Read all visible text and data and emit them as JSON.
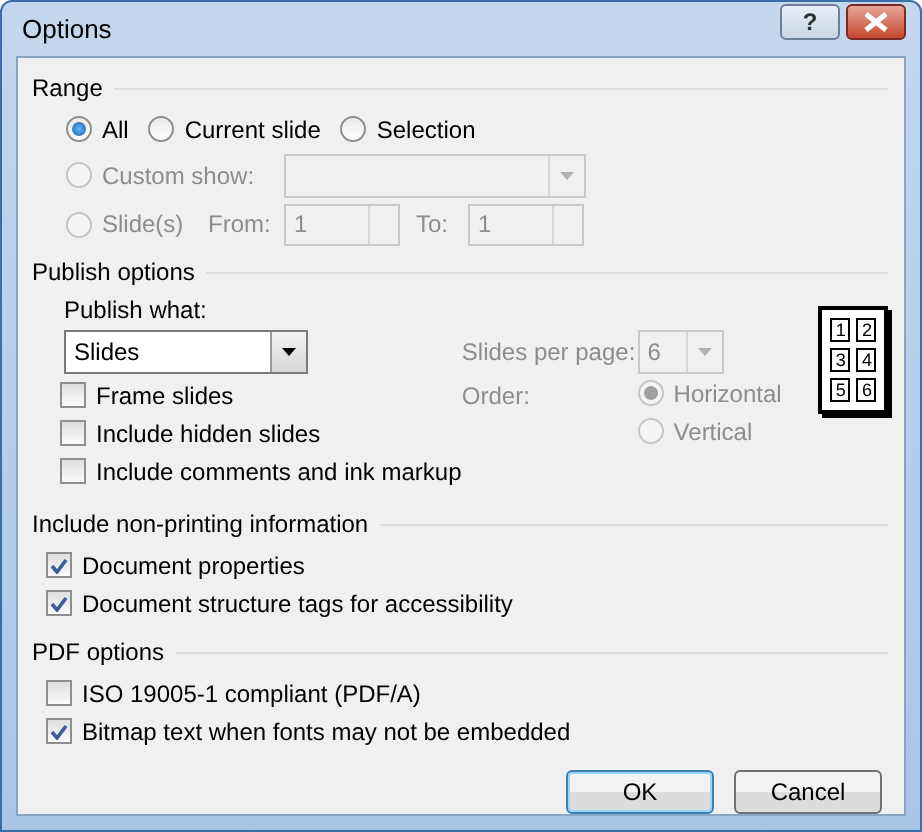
{
  "window": {
    "title": "Options",
    "help_button": "?"
  },
  "range": {
    "label": "Range",
    "options": [
      {
        "label": "All",
        "selected": true,
        "disabled": false
      },
      {
        "label": "Current slide",
        "selected": false,
        "disabled": false
      },
      {
        "label": "Selection",
        "selected": false,
        "disabled": false
      }
    ],
    "custom_show": {
      "label": "Custom show:",
      "selected": false,
      "disabled": true
    },
    "slides": {
      "label": "Slide(s)",
      "selected": false,
      "disabled": true,
      "from": {
        "label": "From:",
        "value": "1"
      },
      "to": {
        "label": "To:",
        "value": "1"
      }
    }
  },
  "publish": {
    "label": "Publish options",
    "what_label": "Publish what:",
    "what_value": "Slides",
    "checks": [
      {
        "label": "Frame slides",
        "checked": false
      },
      {
        "label": "Include hidden slides",
        "checked": false
      },
      {
        "label": "Include comments and ink markup",
        "checked": false
      }
    ],
    "per_page": {
      "label": "Slides per page:",
      "value": "6",
      "disabled": true
    },
    "order": {
      "label": "Order:",
      "disabled": true,
      "options": [
        {
          "label": "Horizontal",
          "selected": true
        },
        {
          "label": "Vertical",
          "selected": false
        }
      ]
    },
    "preview": [
      "1",
      "2",
      "3",
      "4",
      "5",
      "6"
    ]
  },
  "non_printing": {
    "label": "Include non-printing information",
    "checks": [
      {
        "label": "Document properties",
        "checked": true
      },
      {
        "label": "Document structure tags for accessibility",
        "checked": true
      }
    ]
  },
  "pdf": {
    "label": "PDF options",
    "checks": [
      {
        "label": "ISO 19005-1 compliant (PDF/A)",
        "checked": false
      },
      {
        "label": "Bitmap text when fonts may not be embedded",
        "checked": true
      }
    ]
  },
  "buttons": [
    {
      "label": "OK",
      "default": true
    },
    {
      "label": "Cancel",
      "default": false
    }
  ]
}
